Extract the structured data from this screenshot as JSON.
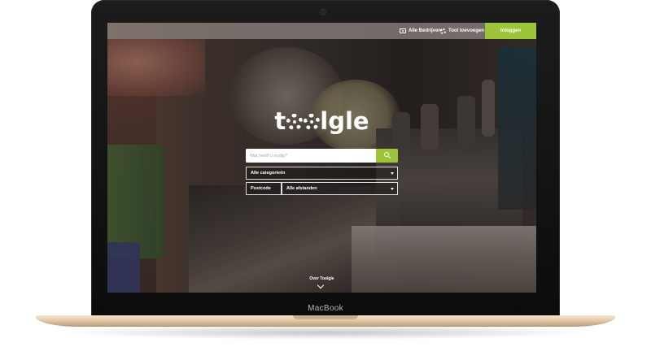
{
  "device": {
    "brand_label": "MacBook"
  },
  "site": {
    "nav": {
      "companies_label": "Alle Bedrijven",
      "add_tool_label": "Tool toevoegen",
      "login_label": "Inloggen"
    },
    "logo_text": {
      "left": "t",
      "right": "lgle"
    },
    "search": {
      "placeholder": "Wat heeft u nodig?"
    },
    "filters": {
      "category_selected": "Alle categorieën",
      "postcode_label": "Postcode",
      "distance_selected": "Alle afstanden"
    },
    "footer_link": "Over Toolgle",
    "colors": {
      "accent": "#9dc43a",
      "text": "#ffffff"
    }
  }
}
